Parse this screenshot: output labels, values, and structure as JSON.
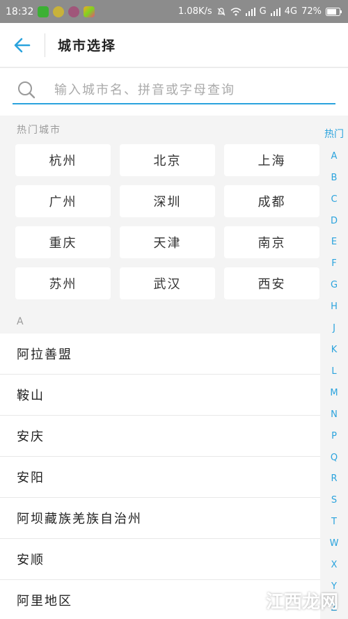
{
  "status_bar": {
    "time": "18:32",
    "speed": "1.08K/s",
    "network": "G",
    "network2": "4G",
    "battery": "72%"
  },
  "header": {
    "title": "城市选择"
  },
  "search": {
    "placeholder": "输入城市名、拼音或字母查询"
  },
  "hot_section": {
    "label": "热门城市",
    "cities": [
      "杭州",
      "北京",
      "上海",
      "广州",
      "深圳",
      "成都",
      "重庆",
      "天津",
      "南京",
      "苏州",
      "武汉",
      "西安"
    ]
  },
  "group_a": {
    "label": "A",
    "cities": [
      "阿拉善盟",
      "鞍山",
      "安庆",
      "安阳",
      "阿坝藏族羌族自治州",
      "安顺",
      "阿里地区"
    ]
  },
  "index_bar": [
    "热门",
    "A",
    "B",
    "C",
    "D",
    "E",
    "F",
    "G",
    "H",
    "J",
    "K",
    "L",
    "M",
    "N",
    "P",
    "Q",
    "R",
    "S",
    "T",
    "W",
    "X",
    "Y",
    "Z"
  ],
  "watermark": {
    "text": "江西龙网"
  },
  "colors": {
    "accent": "#2aa3dd",
    "status_bar": "#8c8c8c",
    "background": "#f4f4f4"
  }
}
